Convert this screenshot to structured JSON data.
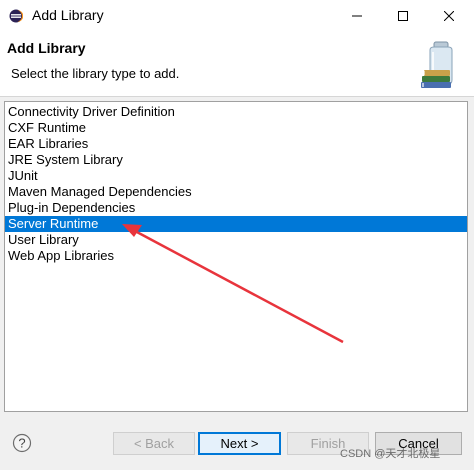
{
  "window": {
    "title": "Add Library",
    "icon": "eclipse-icon"
  },
  "header": {
    "title": "Add Library",
    "description": "Select the library type to add.",
    "image": "library-wizard-icon"
  },
  "library_types": {
    "items": [
      {
        "label": "Connectivity Driver Definition",
        "selected": false
      },
      {
        "label": "CXF Runtime",
        "selected": false
      },
      {
        "label": "EAR Libraries",
        "selected": false
      },
      {
        "label": "JRE System Library",
        "selected": false
      },
      {
        "label": "JUnit",
        "selected": false
      },
      {
        "label": "Maven Managed Dependencies",
        "selected": false
      },
      {
        "label": "Plug-in Dependencies",
        "selected": false
      },
      {
        "label": "Server Runtime",
        "selected": true
      },
      {
        "label": "User Library",
        "selected": false
      },
      {
        "label": "Web App Libraries",
        "selected": false
      }
    ],
    "selected_color": "#0078d7"
  },
  "annotation": {
    "color": "#e8343c",
    "points_to": "Server Runtime"
  },
  "footer": {
    "help": "?",
    "back_label": "< Back",
    "next_label": "Next >",
    "finish_label": "Finish",
    "cancel_label": "Cancel"
  },
  "watermark": "CSDN @天才北极星"
}
